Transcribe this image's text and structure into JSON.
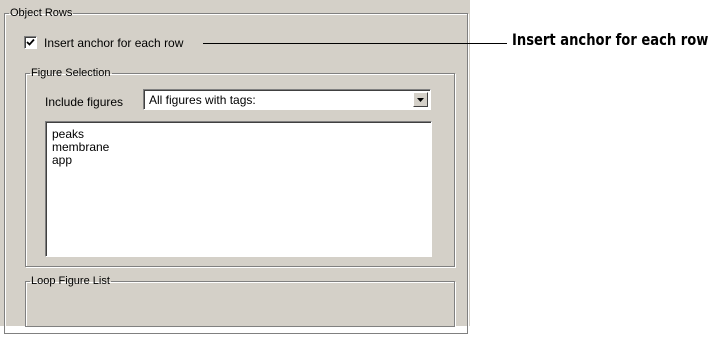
{
  "object_rows": {
    "legend": "Object Rows",
    "insert_anchor": {
      "label": "Insert anchor for each row",
      "checked": true
    }
  },
  "figure_selection": {
    "legend": "Figure Selection",
    "include_figures": {
      "label": "Include figures",
      "value": "All figures with tags:"
    },
    "tags": [
      "peaks",
      "membrane",
      "app"
    ]
  },
  "loop_figure_list": {
    "legend": "Loop Figure List"
  },
  "callout": {
    "text": "Insert anchor for each row"
  },
  "icons": {
    "checkbox": "checkmark-icon",
    "dropdown": "chevron-down-icon"
  }
}
